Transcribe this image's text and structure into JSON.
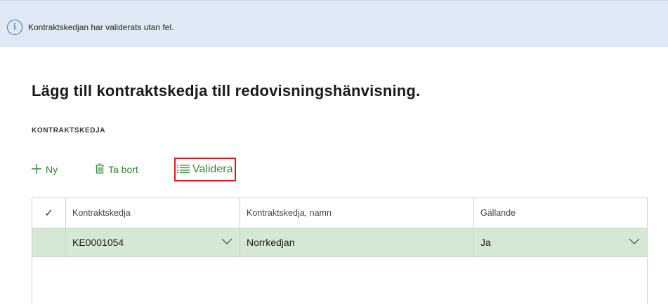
{
  "info_bar": {
    "icon": "info-icon",
    "icon_glyph": "i",
    "message": "Kontraktskedjan har validerats utan fel."
  },
  "page": {
    "title": "Lägg till kontraktskedja till redovisningshänvisning.",
    "section_label": "KONTRAKTSKEDJA"
  },
  "toolbar": {
    "new_label": "Ny",
    "delete_label": "Ta bort",
    "validate_label": "Validera",
    "accent_color": "#2e8b2e",
    "highlight_color": "#e0161b"
  },
  "grid": {
    "columns": [
      "Kontraktskedja",
      "Kontraktskedja, namn",
      "Gällande"
    ],
    "rows": [
      {
        "chain": "KE0001054",
        "name": "Norrkedjan",
        "current": "Ja"
      }
    ],
    "selected_row_color": "#d5e8d4"
  }
}
